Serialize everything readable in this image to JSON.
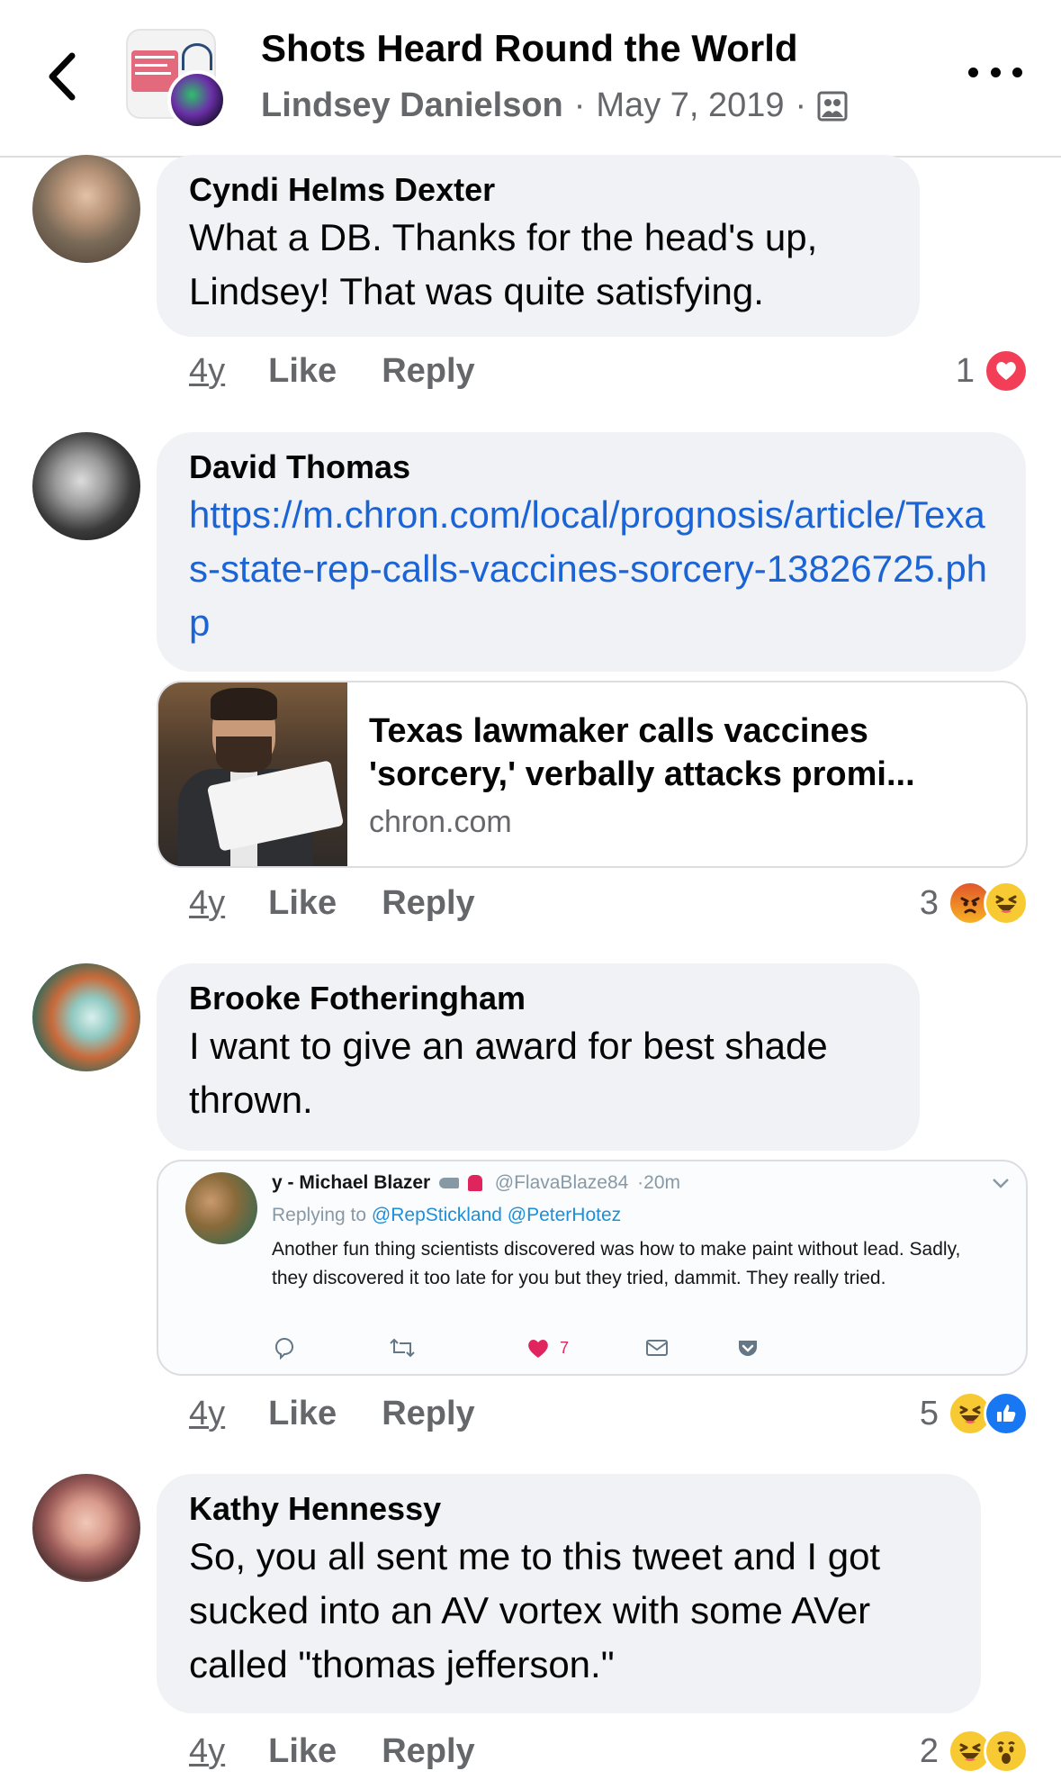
{
  "header": {
    "title": "Shots Heard Round the World",
    "author": "Lindsey Danielson",
    "separator": "·",
    "date": "May 7, 2019"
  },
  "comments": [
    {
      "name": "Cyndi Helms Dexter",
      "text": "What a DB.  Thanks for the head's up, Lindsey!  That was quite satisfying.",
      "time": "4y",
      "like_label": "Like",
      "reply_label": "Reply",
      "reaction_count": "1",
      "reactions": [
        "love"
      ]
    },
    {
      "name": "David Thomas",
      "link": "https://m.chron.com/local/prognosis/article/Texas-state-rep-calls-vaccines-sorcery-13826725.php",
      "preview": {
        "title": "Texas lawmaker calls vaccines 'sorcery,' verbally attacks promi...",
        "domain": "chron.com"
      },
      "time": "4y",
      "like_label": "Like",
      "reply_label": "Reply",
      "reaction_count": "3",
      "reactions": [
        "angry",
        "haha"
      ]
    },
    {
      "name": "Brooke Fotheringham",
      "text": "I want to give an award for best shade thrown.",
      "tweet": {
        "name": "y - Michael Blazer",
        "handle": "@FlavaBlaze84",
        "age": "·20m",
        "replying_to": "Replying to",
        "mentions": "@RepStickland @PeterHotez",
        "text": "Another fun thing scientists discovered was how to make paint without lead. Sadly, they discovered it too late for you but they tried, dammit. They really tried.",
        "like_count": "7"
      },
      "time": "4y",
      "like_label": "Like",
      "reply_label": "Reply",
      "reaction_count": "5",
      "reactions": [
        "haha",
        "like"
      ]
    },
    {
      "name": "Kathy Hennessy",
      "text": "So, you all sent me to this tweet and I got sucked into an AV vortex with some AVer called \"thomas jefferson.\"",
      "time": "4y",
      "like_label": "Like",
      "reply_label": "Reply",
      "reaction_count": "2",
      "reactions": [
        "haha",
        "wow"
      ]
    }
  ],
  "colors": {
    "bubble": "#f0f2f5",
    "link": "#1b64d6",
    "secondary_text": "#65676b",
    "love": "#f33e58",
    "like": "#1877f2"
  },
  "icons": [
    "back-chevron-icon",
    "more-icon",
    "group-privacy-icon",
    "love-reaction-icon",
    "angry-reaction-icon",
    "haha-reaction-icon",
    "like-reaction-icon",
    "wow-reaction-icon"
  ]
}
